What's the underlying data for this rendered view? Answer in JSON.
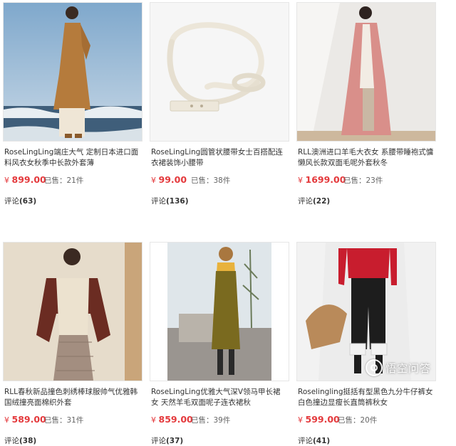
{
  "currency_symbol": "¥",
  "sold_prefix": "已售：",
  "comments_prefix": "评论",
  "products": [
    {
      "title": "RoseLingLing端庄大气 定制日本进口面料风衣女秋季中长款外套薄",
      "price": "899.00",
      "sold": "21件",
      "comments": "(63)",
      "image": "woman-in-camel-trench-coat-on-beach"
    },
    {
      "title": "RoseLingLing圆管状腰带女士百搭配连衣裙装饰小腰带",
      "price": "99.00",
      "sold": "38件",
      "comments": "(136)",
      "image": "cream-leather-belt"
    },
    {
      "title": "RLL澳洲进口羊毛大衣女 系腰带睡袍式慵懒风长款双面毛呢外套秋冬",
      "price": "1699.00",
      "sold": "23件",
      "comments": "(22)",
      "image": "woman-in-pink-wool-coat"
    },
    {
      "title": "RLL春秋新品撞色刺绣棒球服帅气优雅韩国绒撞亮面棉织外套",
      "price": "589.00",
      "sold": "31件",
      "comments": "(38)",
      "image": "woman-in-bomber-jacket-and-plaid-skirt"
    },
    {
      "title": "RoseLingLing优雅大气深V领马甲长裙女 天然羊毛双面呢子连衣裙秋",
      "price": "859.00",
      "sold": "39件",
      "comments": "(37)",
      "image": "woman-in-olive-vest-dress"
    },
    {
      "title": "Roselingling挺括有型黑色九分牛仔裤女白色撞边显瘦长直筒裤秋女",
      "price": "599.00",
      "sold": "20件",
      "comments": "(41)",
      "image": "woman-in-black-cuffed-jeans"
    }
  ],
  "watermark": {
    "text": "悟空问答",
    "icon": "wukong-logo-icon"
  }
}
